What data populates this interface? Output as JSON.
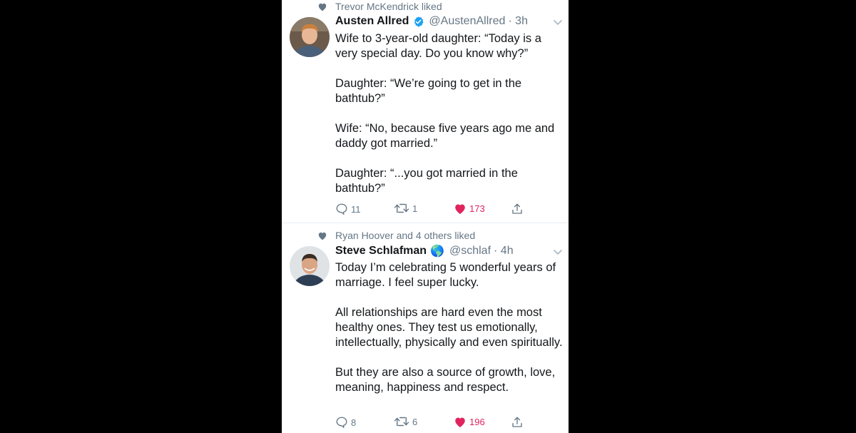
{
  "tweets": [
    {
      "social_context": "Trevor McKendrick liked",
      "name": "Austen Allred",
      "verified": true,
      "handle": "@AustenAllred",
      "time": "· 3h",
      "paragraphs": [
        "Wife to 3-year-old daughter: “Today is a very special day. Do you know why?”",
        "Daughter: “We’re going to get in the bathtub?”",
        "Wife: “No, because five years ago me and daddy got married.”",
        "Daughter: “...you got married in the bathtub?”"
      ],
      "replies": "11",
      "retweets": "1",
      "likes": "173",
      "avatar_bg": "#6b5a4a",
      "avatar_hair": "#c9803f",
      "avatar_shirt": "#4a5f7a"
    },
    {
      "social_context": "Ryan Hoover and 4 others liked",
      "name": "Steve Schlafman",
      "name_emoji": "🌎",
      "handle": "@schlaf",
      "time": "· 4h",
      "paragraphs": [
        "Today I’m celebrating 5 wonderful years of marriage. I feel super lucky.",
        "All relationships are hard even the most healthy ones. They test us emotionally, intellectually, physically and even spiritually.",
        "But they are also a source of growth, love, meaning, happiness and respect."
      ],
      "replies": "8",
      "retweets": "6",
      "likes": "196",
      "avatar_bg": "#dfe3e6",
      "avatar_hair": "#3a2c22",
      "avatar_shirt": "#2d3e55"
    }
  ],
  "colors": {
    "verified": "#1da1f2",
    "like": "#e0245e",
    "secondary": "#657786",
    "primary": "#14171a"
  }
}
